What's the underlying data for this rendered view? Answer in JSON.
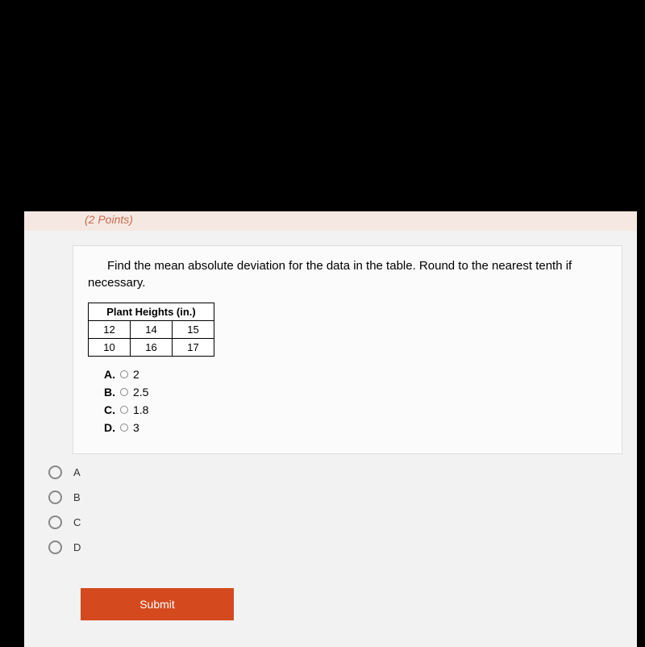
{
  "header": {
    "points": "(2 Points)"
  },
  "question": {
    "text": "Find the mean absolute deviation for the data in the table. Round to the nearest tenth if necessary.",
    "table_header": "Plant Heights (in.)",
    "table": {
      "r1c1": "12",
      "r1c2": "14",
      "r1c3": "15",
      "r2c1": "10",
      "r2c2": "16",
      "r2c3": "17"
    },
    "options": {
      "a_letter": "A.",
      "a_value": "2",
      "b_letter": "B.",
      "b_value": "2.5",
      "c_letter": "C.",
      "c_value": "1.8",
      "d_letter": "D.",
      "d_value": "3"
    }
  },
  "radios": {
    "a": "A",
    "b": "B",
    "c": "C",
    "d": "D"
  },
  "submit": "Submit"
}
